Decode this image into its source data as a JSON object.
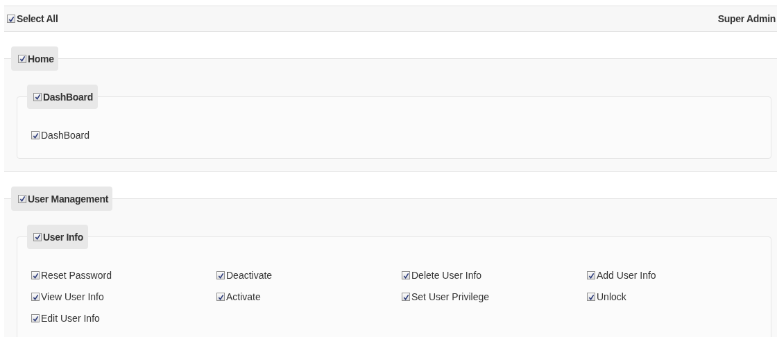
{
  "header": {
    "select_all": {
      "label": "Select All",
      "checked": true
    },
    "role": "Super Admin"
  },
  "sections": [
    {
      "label": "Home",
      "checked": true,
      "groups": [
        {
          "label": "DashBoard",
          "checked": true,
          "permissions": [
            {
              "label": "DashBoard",
              "checked": true
            }
          ]
        }
      ]
    },
    {
      "label": "User Management",
      "checked": true,
      "groups": [
        {
          "label": "User Info",
          "checked": true,
          "permissions": [
            {
              "label": "Reset Password",
              "checked": true
            },
            {
              "label": "Deactivate",
              "checked": true
            },
            {
              "label": "Delete User Info",
              "checked": true
            },
            {
              "label": "Add User Info",
              "checked": true
            },
            {
              "label": "View User Info",
              "checked": true
            },
            {
              "label": "Activate",
              "checked": true
            },
            {
              "label": "Set User Privilege",
              "checked": true
            },
            {
              "label": "Unlock",
              "checked": true
            },
            {
              "label": "Edit User Info",
              "checked": true
            }
          ]
        }
      ]
    }
  ]
}
